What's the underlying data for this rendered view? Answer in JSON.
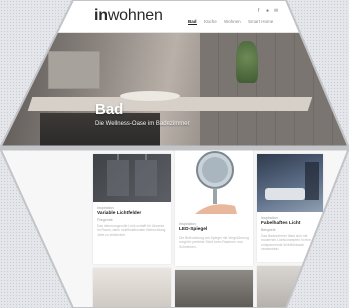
{
  "brand": {
    "logo_bold": "in",
    "logo_light": "wohnen"
  },
  "nav": {
    "items": [
      "Bad",
      "Küche",
      "Wohnen",
      "Smart Home"
    ],
    "active": "Bad",
    "social": [
      "f",
      "●",
      "✉"
    ]
  },
  "hero": {
    "title": "Bad",
    "subtitle": "Die Wellness-Oase im Badezimmer"
  },
  "cards": [
    {
      "category": "Inspiration",
      "title": "Variable Lichtfelder",
      "subtitle": "Fliegende",
      "text": "Das stimmungsvolle Licht schafft für Akzente im Raum, dank multifunktionaler Beleuchtung. Jetzt zu entdecken."
    },
    {
      "category": "Inspiration",
      "title": "LED-Spiegel",
      "subtitle": "",
      "text": "Die Beleuchtung am Spiegel mit Vergrößerung sorgt für perfekte Sicht beim Rasieren und Schminken."
    },
    {
      "category": "Inspiration",
      "title": "Fabelhaftes Licht",
      "subtitle": "Beispiele",
      "text": "Das Badezimmer lässt sich mit modernen Lichtkonzepten in eine entspannende Wohlfühloase verwandeln."
    }
  ],
  "colors": {
    "background": "#e4e6ea",
    "hexagon_border": "#c2c4c8",
    "card_text": "#222222"
  }
}
